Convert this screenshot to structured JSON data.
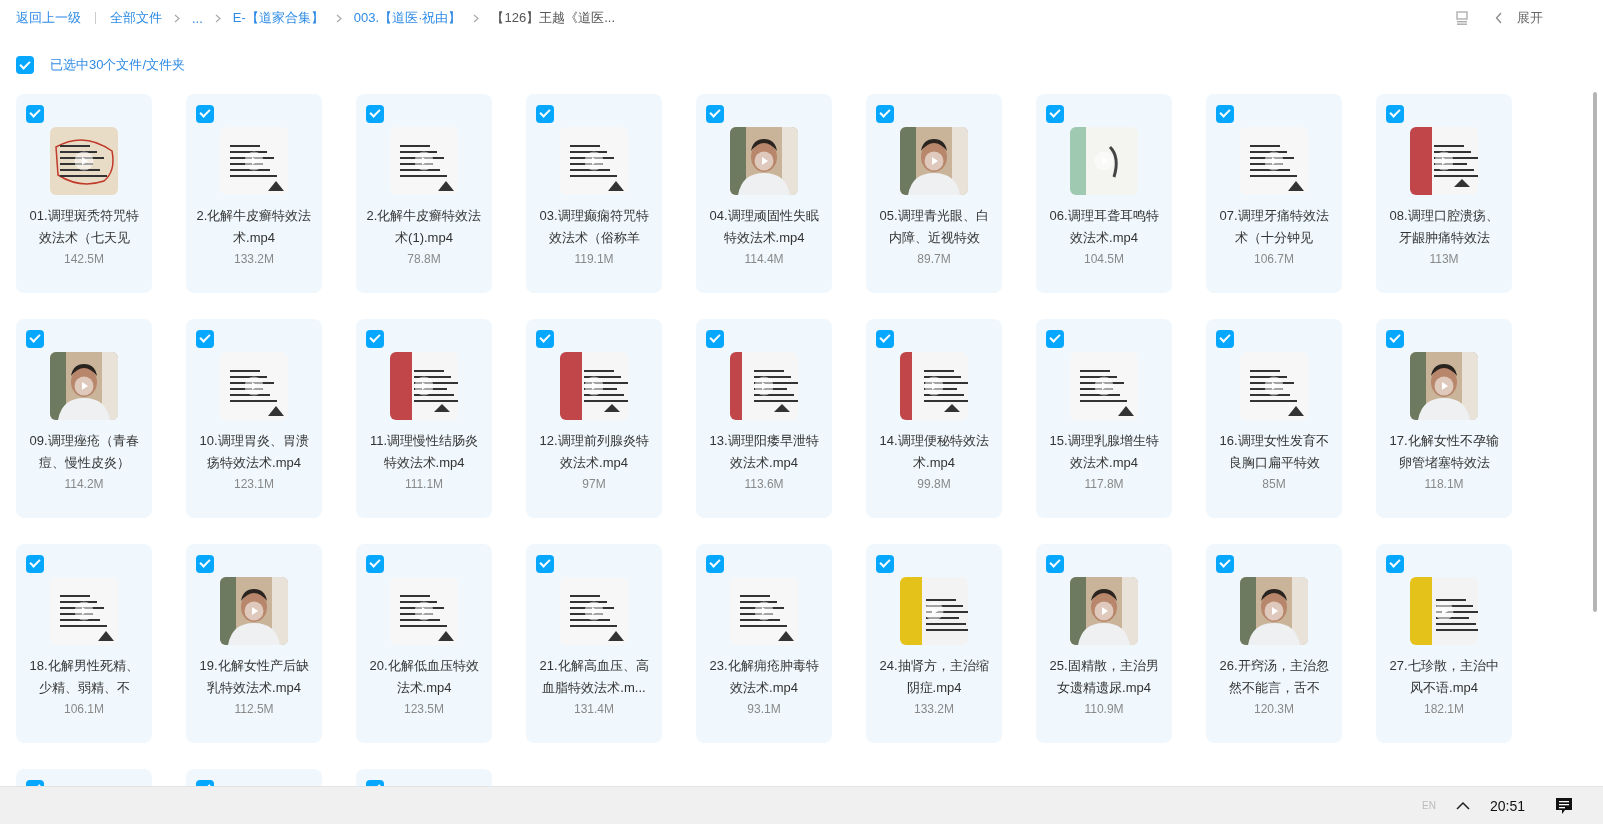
{
  "breadcrumb": {
    "back": "返回上一级",
    "items": [
      {
        "label": "全部文件",
        "kind": "link"
      },
      {
        "label": "...",
        "kind": "link"
      },
      {
        "label": "E-【道家合集】",
        "kind": "link"
      },
      {
        "label": "003.【道医·祝由】",
        "kind": "link"
      },
      {
        "label": "【126】王越《道医...",
        "kind": "current"
      }
    ]
  },
  "toolbar": {
    "expand": "展开"
  },
  "selection": {
    "checked": true,
    "label": "已选中30个文件/文件夹"
  },
  "files": [
    {
      "name": "01.调理斑秃符咒特效法术（七天见",
      "size": "142.5M",
      "checked": true
    },
    {
      "name": "2.化解牛皮癣特效法术.mp4",
      "size": "133.2M",
      "checked": true
    },
    {
      "name": "2.化解牛皮癣特效法术(1).mp4",
      "size": "78.8M",
      "checked": true
    },
    {
      "name": "03.调理癫痫符咒特效法术（俗称羊",
      "size": "119.1M",
      "checked": true
    },
    {
      "name": "04.调理顽固性失眠特效法术.mp4",
      "size": "114.4M",
      "checked": true
    },
    {
      "name": "05.调理青光眼、白内障、近视特效",
      "size": "89.7M",
      "checked": true
    },
    {
      "name": "06.调理耳聋耳鸣特效法术.mp4",
      "size": "104.5M",
      "checked": true
    },
    {
      "name": "07.调理牙痛特效法术（十分钟见",
      "size": "106.7M",
      "checked": true
    },
    {
      "name": "08.调理口腔溃疡、牙龈肿痛特效法",
      "size": "113M",
      "checked": true
    },
    {
      "name": "09.调理痤疮（青春痘、慢性皮炎）",
      "size": "114.2M",
      "checked": true
    },
    {
      "name": "10.调理胃炎、胃溃疡特效法术.mp4",
      "size": "123.1M",
      "checked": true
    },
    {
      "name": "11.调理慢性结肠炎特效法术.mp4",
      "size": "111.1M",
      "checked": true
    },
    {
      "name": "12.调理前列腺炎特效法术.mp4",
      "size": "97M",
      "checked": true
    },
    {
      "name": "13.调理阳痿早泄特效法术.mp4",
      "size": "113.6M",
      "checked": true
    },
    {
      "name": "14.调理便秘特效法术.mp4",
      "size": "99.8M",
      "checked": true
    },
    {
      "name": "15.调理乳腺增生特效法术.mp4",
      "size": "117.8M",
      "checked": true
    },
    {
      "name": "16.调理女性发育不良胸口扁平特效",
      "size": "85M",
      "checked": true
    },
    {
      "name": "17.化解女性不孕输卵管堵塞特效法",
      "size": "118.1M",
      "checked": true
    },
    {
      "name": "18.化解男性死精、少精、弱精、不",
      "size": "106.1M",
      "checked": true
    },
    {
      "name": "19.化解女性产后缺乳特效法术.mp4",
      "size": "112.5M",
      "checked": true
    },
    {
      "name": "20.化解低血压特效法术.mp4",
      "size": "123.5M",
      "checked": true
    },
    {
      "name": "21.化解高血压、高血脂特效法术.m...",
      "size": "131.4M",
      "checked": true
    },
    {
      "name": "23.化解痈疮肿毒特效法术.mp4",
      "size": "93.1M",
      "checked": true
    },
    {
      "name": "24.抽肾方，主治缩阴症.mp4",
      "size": "133.2M",
      "checked": true
    },
    {
      "name": "25.固精散，主治男女遗精遗尿.mp4",
      "size": "110.9M",
      "checked": true
    },
    {
      "name": "26.开窍汤，主治忽然不能言，舌不",
      "size": "120.3M",
      "checked": true
    },
    {
      "name": "27.七珍散，主治中风不语.mp4",
      "size": "182.1M",
      "checked": true
    },
    {
      "checked": true
    },
    {
      "checked": true
    },
    {
      "checked": true
    }
  ],
  "taskbar": {
    "language": "EN",
    "time": "20:51"
  }
}
